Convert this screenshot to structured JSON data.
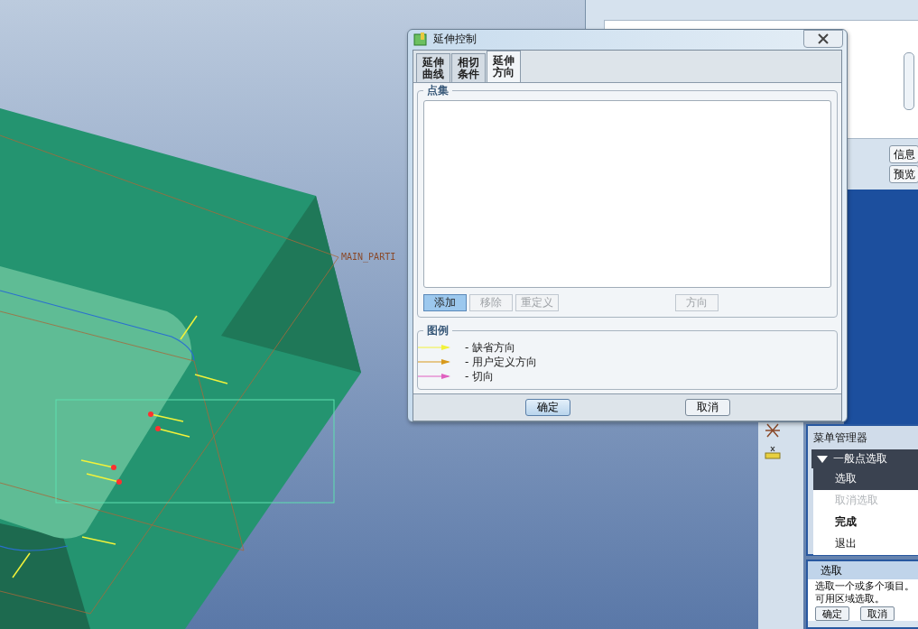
{
  "viewport": {
    "model_label": "MAIN_PARTI"
  },
  "dialog": {
    "title": "延伸控制",
    "tabs": [
      {
        "label": "延伸曲线",
        "selected": false
      },
      {
        "label": "相切条件",
        "selected": false
      },
      {
        "label": "延伸方向",
        "selected": true
      }
    ],
    "point_set": {
      "title": "点集",
      "buttons": [
        {
          "label": "添加",
          "disabled": false,
          "focused": true
        },
        {
          "label": "移除",
          "disabled": true,
          "focused": false
        },
        {
          "label": "重定义",
          "disabled": true,
          "focused": false
        },
        {
          "label": "方向",
          "disabled": true,
          "focused": false
        }
      ]
    },
    "legend": {
      "title": "图例",
      "items": [
        {
          "label": "- 缺省方向",
          "color": "#f2f23a"
        },
        {
          "label": "- 用户定义方向",
          "color": "#d89a1c"
        },
        {
          "label": "- 切向",
          "color": "#e060c0"
        }
      ]
    },
    "footer_buttons": [
      {
        "label": "确定",
        "focused": true
      },
      {
        "label": "取消",
        "focused": false
      }
    ]
  },
  "back_window": {
    "buttons": [
      "信息",
      "预览"
    ]
  },
  "menu_manager": {
    "title": "菜单管理器",
    "section": {
      "label": "一般点选取",
      "expanded": true,
      "items": [
        {
          "label": "选取",
          "selected": true,
          "disabled": false,
          "bold": false
        },
        {
          "label": "取消选取",
          "selected": false,
          "disabled": true,
          "bold": false
        },
        {
          "label": "完成",
          "selected": false,
          "disabled": false,
          "bold": true
        },
        {
          "label": "退出",
          "selected": false,
          "disabled": false,
          "bold": false
        }
      ]
    }
  },
  "select_dialog": {
    "title": "选取",
    "lines": [
      "选取一个或多个项目。",
      "可用区域选取。"
    ],
    "buttons": [
      "确定",
      "取消"
    ]
  }
}
